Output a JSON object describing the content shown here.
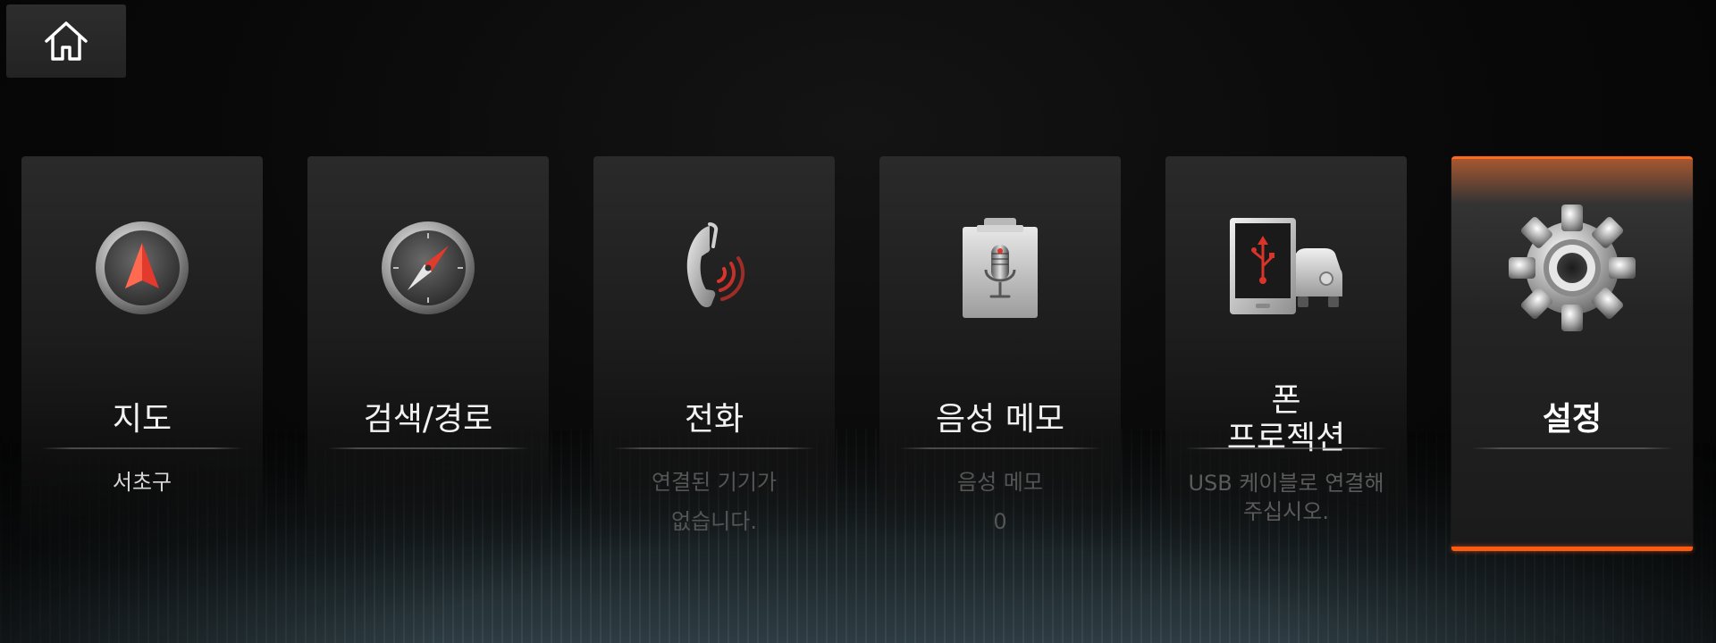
{
  "home": {
    "icon": "home-icon"
  },
  "tiles": [
    {
      "id": "map",
      "title": "지도",
      "subtitle": "서초구",
      "icon": "navigation-arrow-icon"
    },
    {
      "id": "search",
      "title": "검색/경로",
      "subtitle": "",
      "icon": "compass-icon"
    },
    {
      "id": "phone",
      "title": "전화",
      "subtitle_lines": [
        "연결된 기기가",
        "없습니다."
      ],
      "icon": "phone-icon"
    },
    {
      "id": "voice-memo",
      "title": "음성 메모",
      "subtitle_lines": [
        "음성 메모",
        "0"
      ],
      "icon": "microphone-icon"
    },
    {
      "id": "phone-projection",
      "title_lines": [
        "폰",
        "프로젝션"
      ],
      "subtitle_lines": [
        "USB 케이블로 연결해",
        "주십시오."
      ],
      "icon": "phone-car-usb-icon"
    },
    {
      "id": "settings",
      "title": "설정",
      "subtitle": "",
      "icon": "gear-icon",
      "active": true
    }
  ],
  "colors": {
    "accent": "#ff6a1e",
    "background": "#050505",
    "tile": "#252525",
    "text": "#f2f2f2",
    "dim_text": "#555555"
  }
}
